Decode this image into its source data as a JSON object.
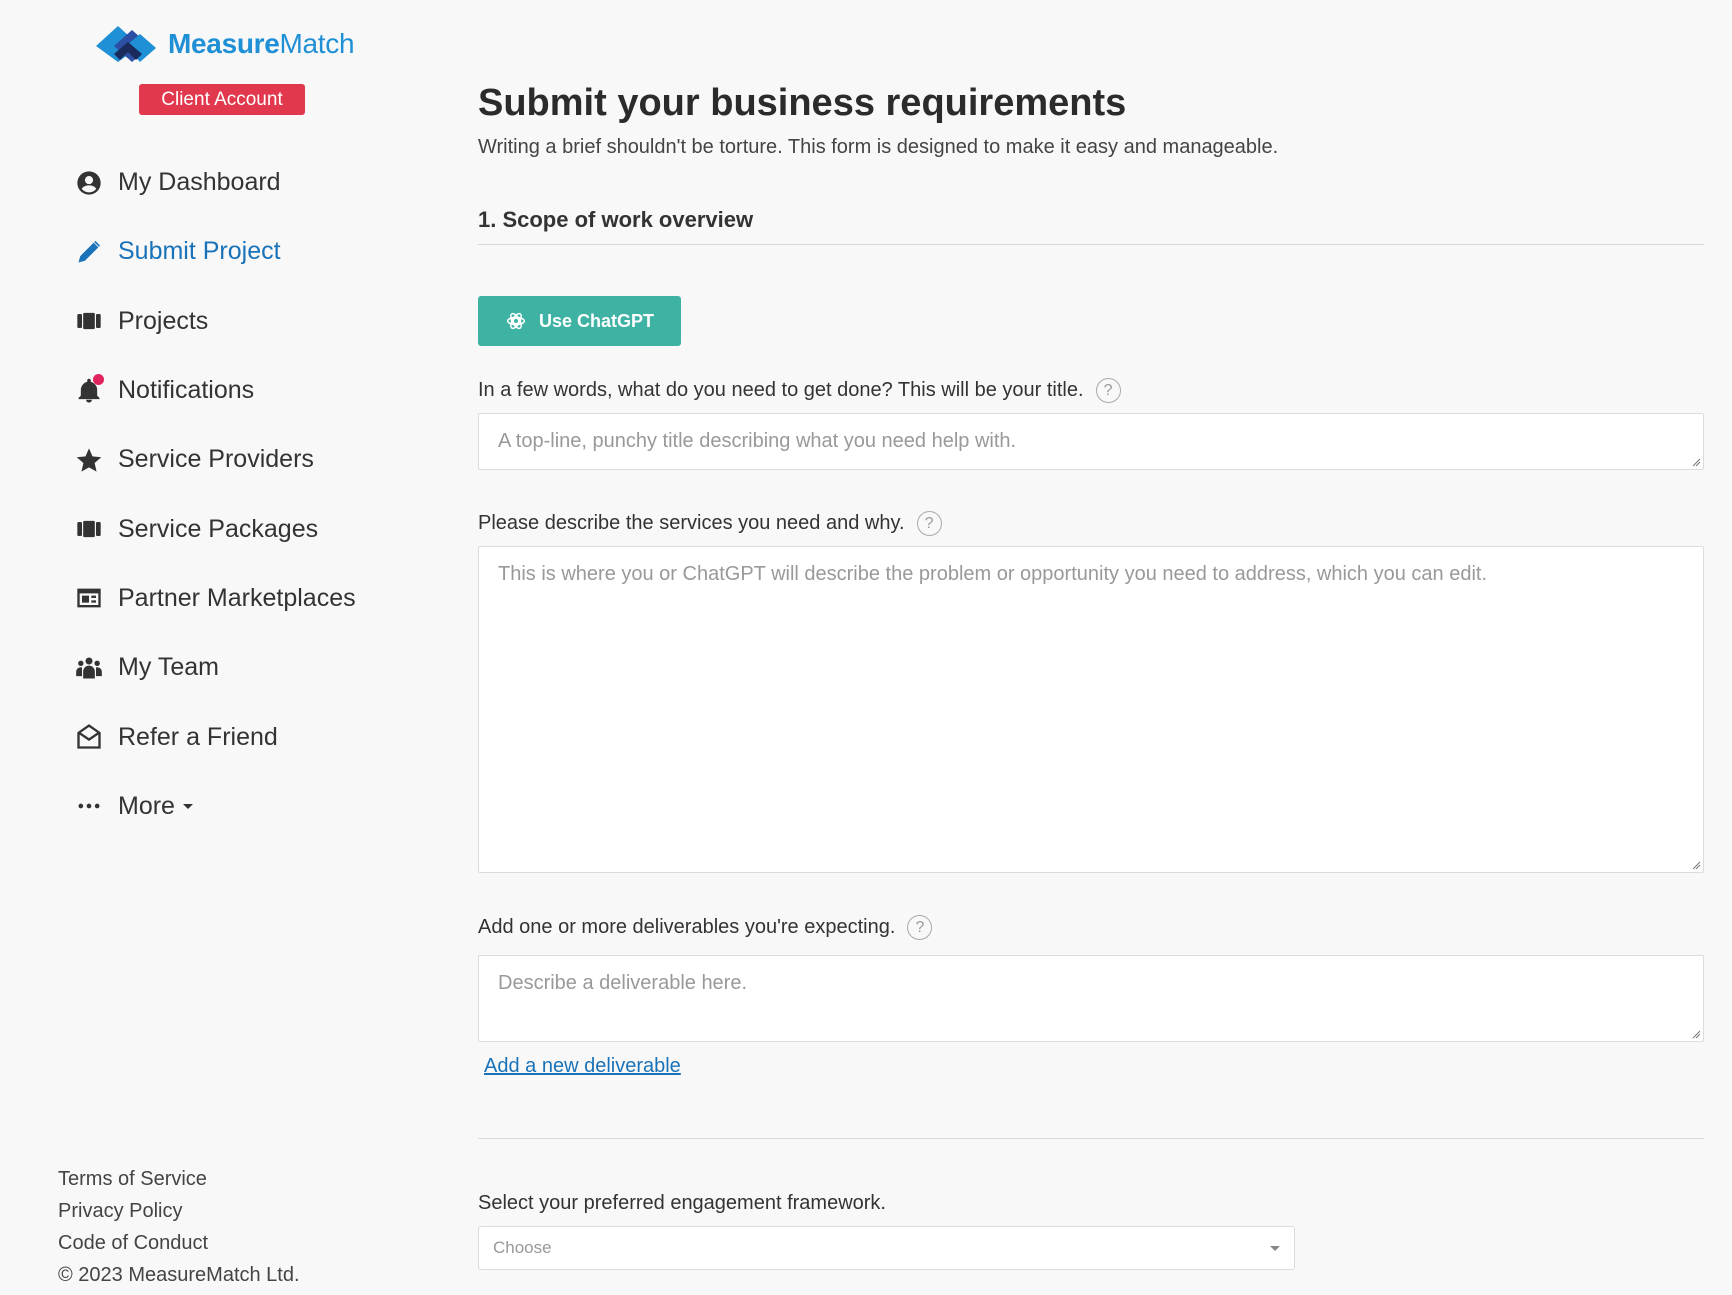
{
  "brand": {
    "name_bold": "Measure",
    "name_light": "Match",
    "account_badge": "Client Account",
    "accent": "#1f8fd6",
    "badge_color": "#e1384d"
  },
  "sidebar": {
    "items": [
      {
        "label": "My Dashboard",
        "icon": "user-circle-icon"
      },
      {
        "label": "Submit Project",
        "icon": "pencil-icon",
        "active": true
      },
      {
        "label": "Projects",
        "icon": "briefcase-icon"
      },
      {
        "label": "Notifications",
        "icon": "bell-icon"
      },
      {
        "label": "Service Providers",
        "icon": "star-icon"
      },
      {
        "label": "Service Packages",
        "icon": "package-icon"
      },
      {
        "label": "Partner Marketplaces",
        "icon": "marketplace-icon"
      },
      {
        "label": "My Team",
        "icon": "team-icon"
      },
      {
        "label": "Refer a Friend",
        "icon": "envelope-icon"
      },
      {
        "label": "More",
        "icon": "ellipsis-icon"
      }
    ],
    "footer": [
      "Terms of Service",
      "Privacy Policy",
      "Code of Conduct",
      "© 2023 MeasureMatch Ltd."
    ]
  },
  "main": {
    "title": "Submit your business requirements",
    "subtitle": "Writing a brief shouldn't be torture. This form is designed to make it easy and manageable.",
    "section_title": "1. Scope of work overview",
    "gpt_button": "Use ChatGPT",
    "gpt_color": "#3fb3a3",
    "fields": {
      "title_label": "In a few words, what do you need to get done? This will be your title.",
      "title_placeholder": "A top-line, punchy title describing what you need help with.",
      "services_label": "Please describe the services you need and why.",
      "services_placeholder": "This is where you or ChatGPT will describe the problem or opportunity you need to address, which you can edit.",
      "deliverables_label": "Add one or more deliverables you're expecting.",
      "deliverables_placeholder": "Describe a deliverable here.",
      "add_deliverable": "Add a new deliverable",
      "framework_label": "Select your preferred engagement framework.",
      "framework_value": "Choose"
    },
    "help_glyph": "?"
  }
}
